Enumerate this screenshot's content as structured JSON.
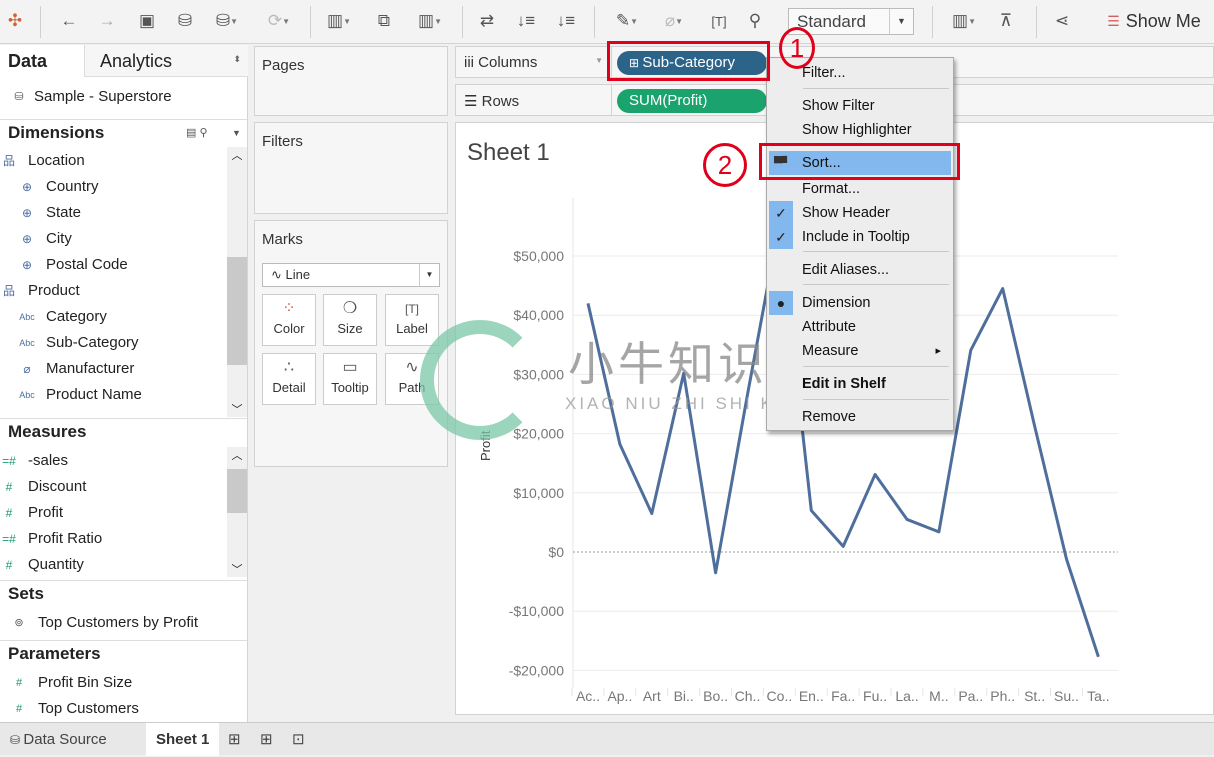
{
  "toolbar": {
    "mark_size": "Standard",
    "show_me": "Show Me",
    "icons": [
      "tableau-logo-icon",
      "undo-icon",
      "redo-icon",
      "save-icon",
      "new-datasource-icon",
      "pause-updates-icon",
      "refresh-icon",
      "new-worksheet-icon",
      "duplicate-sheet-icon",
      "clear-sheet-icon",
      "swap-icon",
      "sort-ascending-icon",
      "sort-descending-icon",
      "highlight-icon",
      "group-icon",
      "label-icon",
      "pin-icon",
      "fit-icon",
      "presentation-icon",
      "share-icon"
    ]
  },
  "left_pane": {
    "tab_data": "Data",
    "tab_analytics": "Analytics",
    "datasource": "Sample - Superstore",
    "dimensions_title": "Dimensions",
    "dimensions": [
      {
        "label": "Location",
        "icon": "hierarchy-icon"
      },
      {
        "label": "Country",
        "icon": "globe-icon"
      },
      {
        "label": "State",
        "icon": "globe-icon"
      },
      {
        "label": "City",
        "icon": "globe-icon"
      },
      {
        "label": "Postal Code",
        "icon": "globe-icon"
      },
      {
        "label": "Product",
        "icon": "hierarchy-icon"
      },
      {
        "label": "Category",
        "icon": "abc-icon"
      },
      {
        "label": "Sub-Category",
        "icon": "abc-icon"
      },
      {
        "label": "Manufacturer",
        "icon": "paperclip-icon"
      },
      {
        "label": "Product Name",
        "icon": "abc-icon"
      }
    ],
    "measures_title": "Measures",
    "measures": [
      {
        "label": "-sales",
        "icon": "calc-number-icon"
      },
      {
        "label": "Discount",
        "icon": "number-icon"
      },
      {
        "label": "Profit",
        "icon": "number-icon"
      },
      {
        "label": "Profit Ratio",
        "icon": "calc-number-icon"
      },
      {
        "label": "Quantity",
        "icon": "number-icon"
      }
    ],
    "sets_title": "Sets",
    "sets": [
      {
        "label": "Top Customers by Profit"
      }
    ],
    "parameters_title": "Parameters",
    "parameters": [
      {
        "label": "Profit Bin Size"
      },
      {
        "label": "Top Customers"
      }
    ]
  },
  "cards": {
    "pages": "Pages",
    "filters": "Filters",
    "marks": "Marks",
    "mark_type": "Line",
    "mark_buttons": [
      {
        "label": "Color"
      },
      {
        "label": "Size"
      },
      {
        "label": "Label"
      },
      {
        "label": "Detail"
      },
      {
        "label": "Tooltip"
      },
      {
        "label": "Path"
      }
    ]
  },
  "shelves": {
    "columns": "Columns",
    "rows": "Rows",
    "columns_pill": "Sub-Category",
    "rows_pill": "SUM(Profit)"
  },
  "sheet_title": "Sheet 1",
  "context_menu": {
    "items": [
      "Filter...",
      "Show Filter",
      "Show Highlighter",
      "Sort...",
      "Format...",
      "Show Header",
      "Include in Tooltip",
      "Edit Aliases...",
      "Dimension",
      "Attribute",
      "Measure",
      "Edit in Shelf",
      "Remove"
    ],
    "highlighted": "Sort..."
  },
  "annotations": {
    "step1": "1",
    "step2": "2"
  },
  "watermark": {
    "cn": "小牛知识库",
    "en": "XIAO NIU ZHI SHI KU"
  },
  "bottom": {
    "data_source": "Data Source",
    "sheet": "Sheet 1"
  },
  "chart_data": {
    "type": "line",
    "ylabel": "Profit",
    "categories": [
      "Ac..",
      "Ap..",
      "Art",
      "Bi..",
      "Bo..",
      "Ch..",
      "Co..",
      "En..",
      "Fa..",
      "Fu..",
      "La..",
      "M..",
      "Pa..",
      "Ph..",
      "St..",
      "Su..",
      "Ta.."
    ],
    "values": [
      42000,
      18200,
      6500,
      30200,
      -3500,
      26600,
      55600,
      7000,
      950,
      13100,
      5500,
      3400,
      34100,
      44500,
      21300,
      -1200,
      -17700
    ],
    "yticks": [
      "$50,000",
      "$40,000",
      "$30,000",
      "$20,000",
      "$10,000",
      "$0",
      "-$10,000",
      "-$20,000"
    ],
    "ytick_values": [
      50000,
      40000,
      30000,
      20000,
      10000,
      0,
      -10000,
      -20000
    ],
    "ylim": [
      -22000,
      58000
    ],
    "grid": true,
    "line_color": "#4e6e9c"
  }
}
